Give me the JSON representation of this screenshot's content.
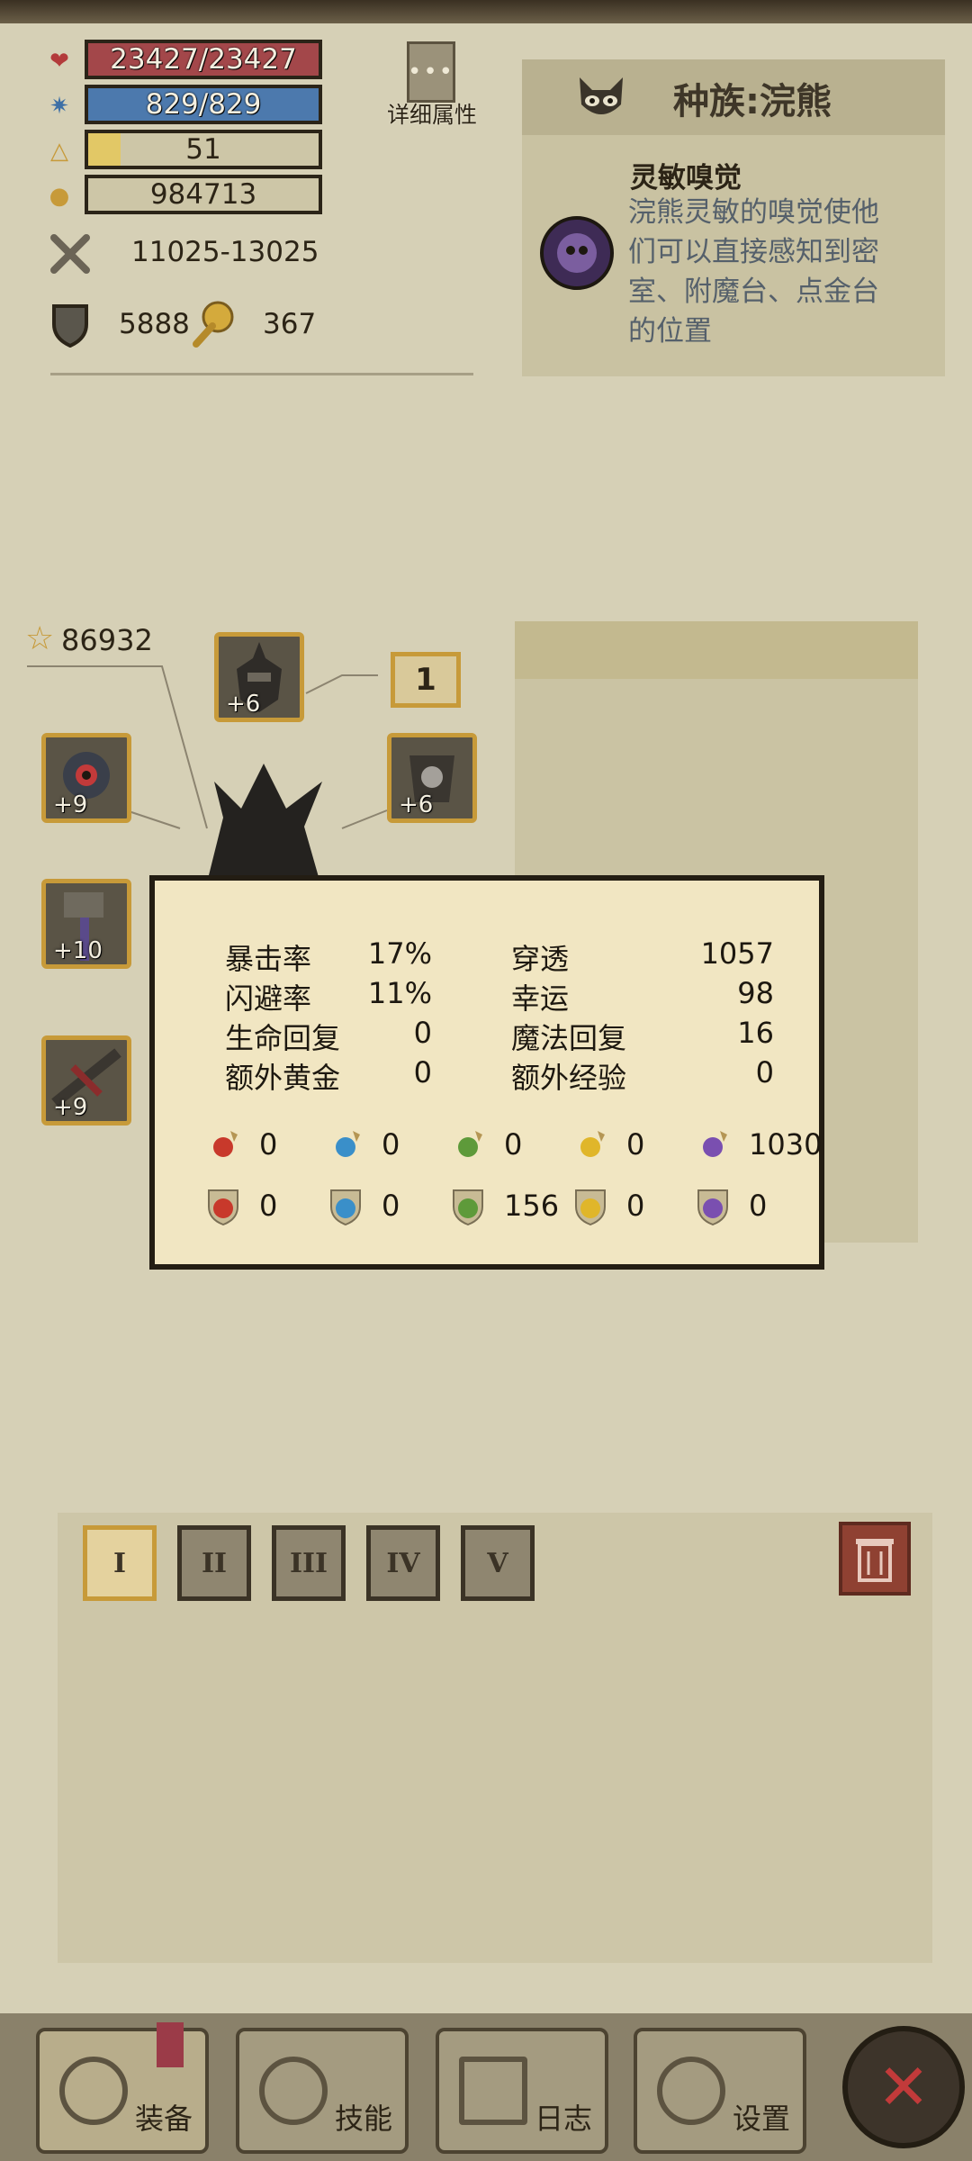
{
  "stats": {
    "hp": "23427/23427",
    "mp": "829/829",
    "level": "51",
    "gold": "984713",
    "attack": "11025-13025",
    "defense": "5888",
    "gem": "367",
    "hp_fill": 1.0,
    "mp_fill": 1.0,
    "level_fill": 0.14
  },
  "detail_button": "详细属性",
  "race": {
    "title": "种族:浣熊",
    "skill_name": "灵敏嗅觉",
    "skill_desc_1": "浣熊灵敏的嗅觉使他",
    "skill_desc_2": "们可以直接感知到密",
    "skill_desc_3": "室、附魔台、点金台",
    "skill_desc_4": "的位置"
  },
  "character": {
    "score": "86932",
    "level_box": "1",
    "slots": {
      "helmet": "+6",
      "amulet": "+9",
      "armor": "+6",
      "weapon_left": "+10",
      "weapon_right": "+9"
    }
  },
  "tooltip": {
    "rows": [
      {
        "l1": "暴击率",
        "v1": "17%",
        "l2": "穿透",
        "v2": "1057"
      },
      {
        "l1": "闪避率",
        "v1": "11%",
        "l2": "幸运",
        "v2": "98"
      },
      {
        "l1": "生命回复",
        "v1": "0",
        "l2": "魔法回复",
        "v2": "16"
      },
      {
        "l1": "额外黄金",
        "v1": "0",
        "l2": "额外经验",
        "v2": "0"
      }
    ],
    "attack_elements": [
      "0",
      "0",
      "0",
      "0",
      "1030"
    ],
    "resist_elements": [
      "0",
      "0",
      "156",
      "0",
      "0"
    ],
    "element_colors": [
      "#c8392b",
      "#3a8fc9",
      "#5e9a3a",
      "#e0b62a",
      "#7a4fb0"
    ],
    "element_icons": [
      "fire-icon",
      "water-icon",
      "leaf-icon",
      "lightning-icon",
      "arcane-icon"
    ]
  },
  "tabs": [
    "I",
    "II",
    "III",
    "IV",
    "V"
  ],
  "nav": {
    "equip": "装备",
    "skills": "技能",
    "log": "日志",
    "settings": "设置"
  }
}
